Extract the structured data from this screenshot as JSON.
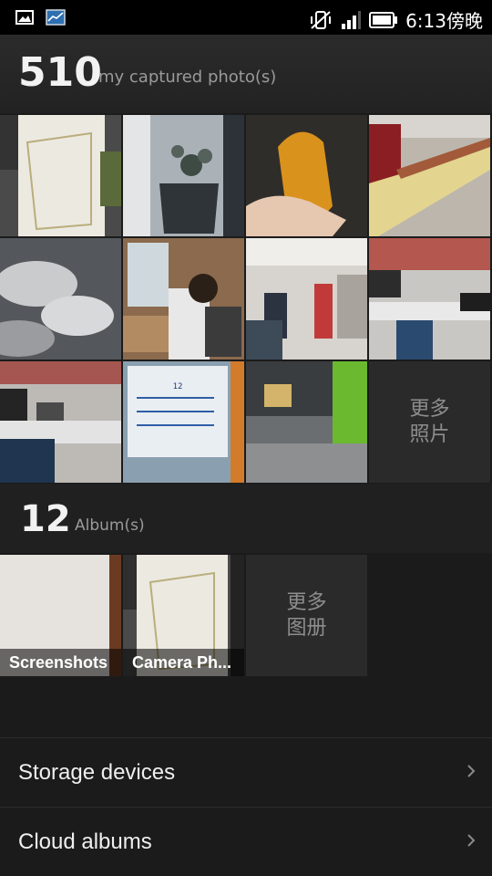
{
  "status_bar": {
    "time": "6:13傍晚",
    "left_icons": [
      "image-notification-icon",
      "chart-notification-icon"
    ],
    "right_icons": [
      "vibrate-off-icon",
      "signal-icon",
      "battery-icon"
    ]
  },
  "photos_section": {
    "count": "510",
    "label": "my captured photo(s)",
    "more_label_line1": "更多",
    "more_label_line2": "照片"
  },
  "albums_section": {
    "count": "12",
    "label": "Album(s)",
    "albums": [
      {
        "name": "Screenshots"
      },
      {
        "name": "Camera Ph..."
      }
    ],
    "more_label_line1": "更多",
    "more_label_line2": "图册"
  },
  "list": {
    "items": [
      {
        "label": "Storage devices"
      },
      {
        "label": "Cloud albums"
      }
    ]
  }
}
